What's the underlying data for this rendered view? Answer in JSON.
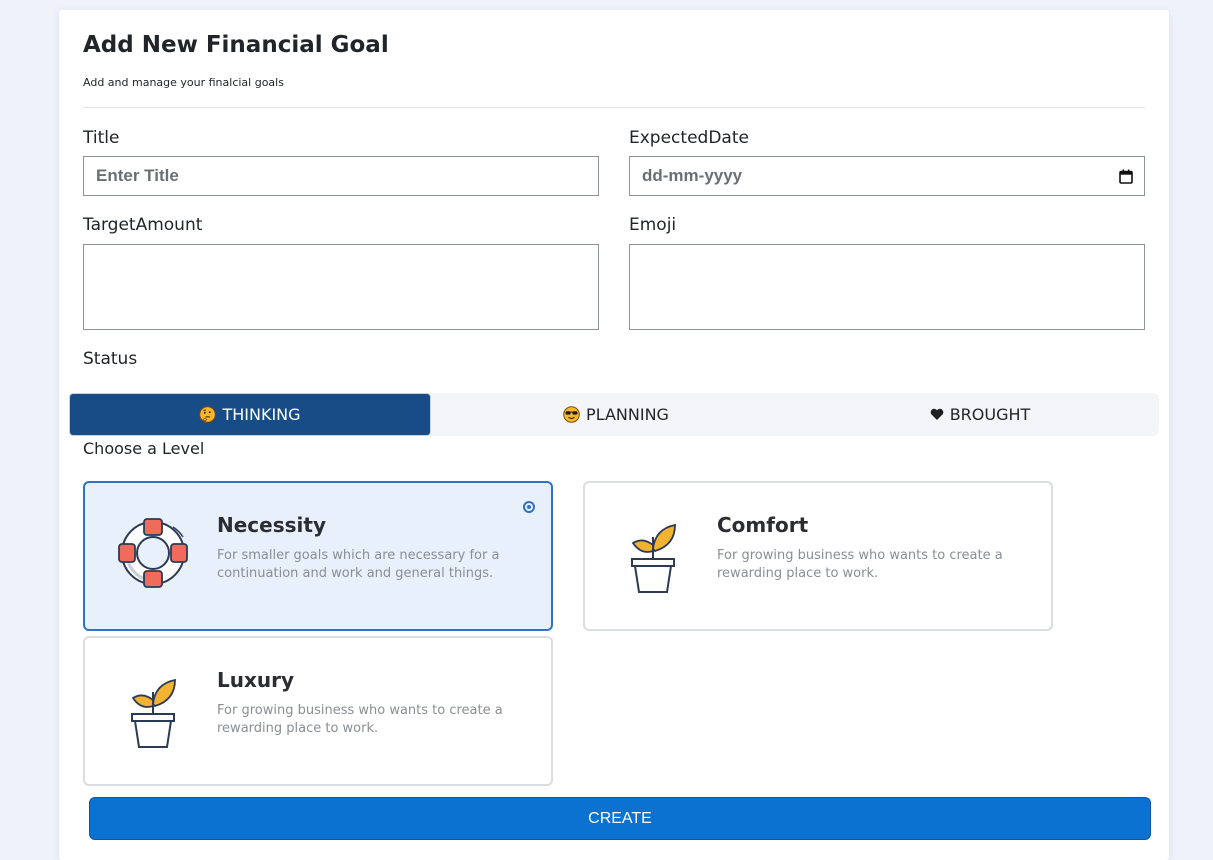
{
  "header": {
    "title": "Add New Financial Goal",
    "subtitle": "Add and manage your finalcial goals"
  },
  "form": {
    "title": {
      "label": "Title",
      "placeholder": "Enter Title",
      "value": ""
    },
    "expected_date": {
      "label": "ExpectedDate",
      "placeholder": "dd-mm-yyyy",
      "icon": "calendar-icon"
    },
    "target_amount": {
      "label": "TargetAmount",
      "value": ""
    },
    "emoji": {
      "label": "Emoji",
      "value": ""
    }
  },
  "status": {
    "label": "Status",
    "selected": "THINKING",
    "tabs": [
      {
        "label": "THINKING",
        "icon": "thinking-face-icon",
        "active": true
      },
      {
        "label": "PLANNING",
        "icon": "sunglasses-face-icon",
        "active": false
      },
      {
        "label": "BROUGHT",
        "icon": "heart-icon",
        "active": false
      }
    ]
  },
  "level": {
    "label": "Choose a Level",
    "selected": "Necessity",
    "options": [
      {
        "name": "Necessity",
        "description": "For smaller goals which are necessary for a continuation and work and general things.",
        "icon": "lifebuoy-icon",
        "selected": true
      },
      {
        "name": "Comfort",
        "description": "For growing business who wants to create a rewarding place to work.",
        "icon": "plant-pot-icon",
        "selected": false
      },
      {
        "name": "Luxury",
        "description": "For growing business who wants to create a rewarding place to work.",
        "icon": "plant-pot-icon",
        "selected": false
      }
    ]
  },
  "actions": {
    "create_label": "CREATE"
  },
  "colors": {
    "active_tab": "#174c86",
    "primary_button": "#0b72d2",
    "selected_card_border": "#2f72c4",
    "selected_card_bg": "#e8f0fc",
    "page_bg": "#eef2fb"
  }
}
